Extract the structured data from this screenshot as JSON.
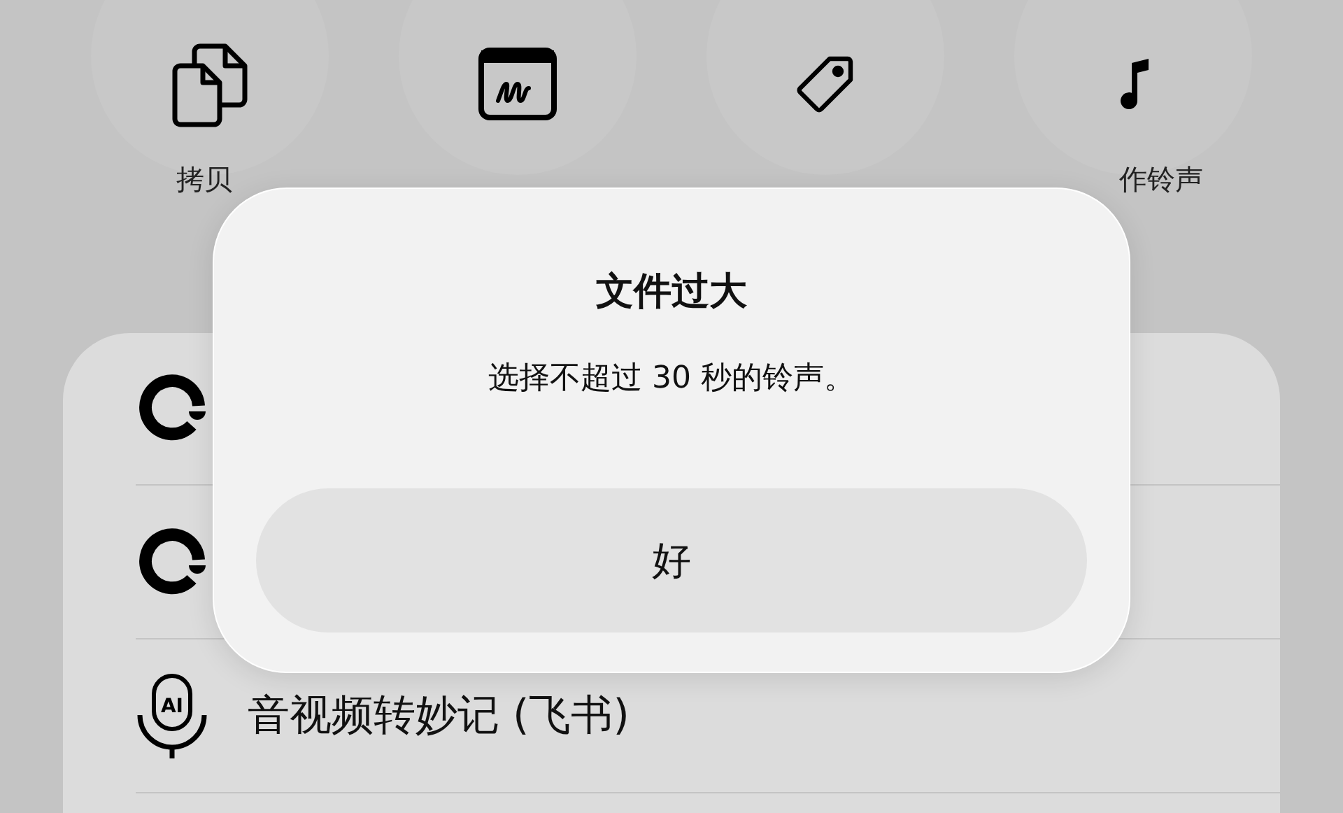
{
  "actions": [
    {
      "kind": "copy",
      "label": "拷贝"
    },
    {
      "kind": "markup"
    },
    {
      "kind": "tag"
    },
    {
      "kind": "ringtone",
      "label": "作铃声"
    }
  ],
  "list": [
    {
      "kind": "circle"
    },
    {
      "kind": "circle"
    },
    {
      "kind": "ai-mic",
      "icon_text": "AI",
      "label": "音视频转妙记 (飞书)"
    },
    {
      "kind": "blank"
    }
  ],
  "alert": {
    "title": "文件过大",
    "message": "选择不超过 30 秒的铃声。",
    "buttons": [
      "好"
    ]
  }
}
